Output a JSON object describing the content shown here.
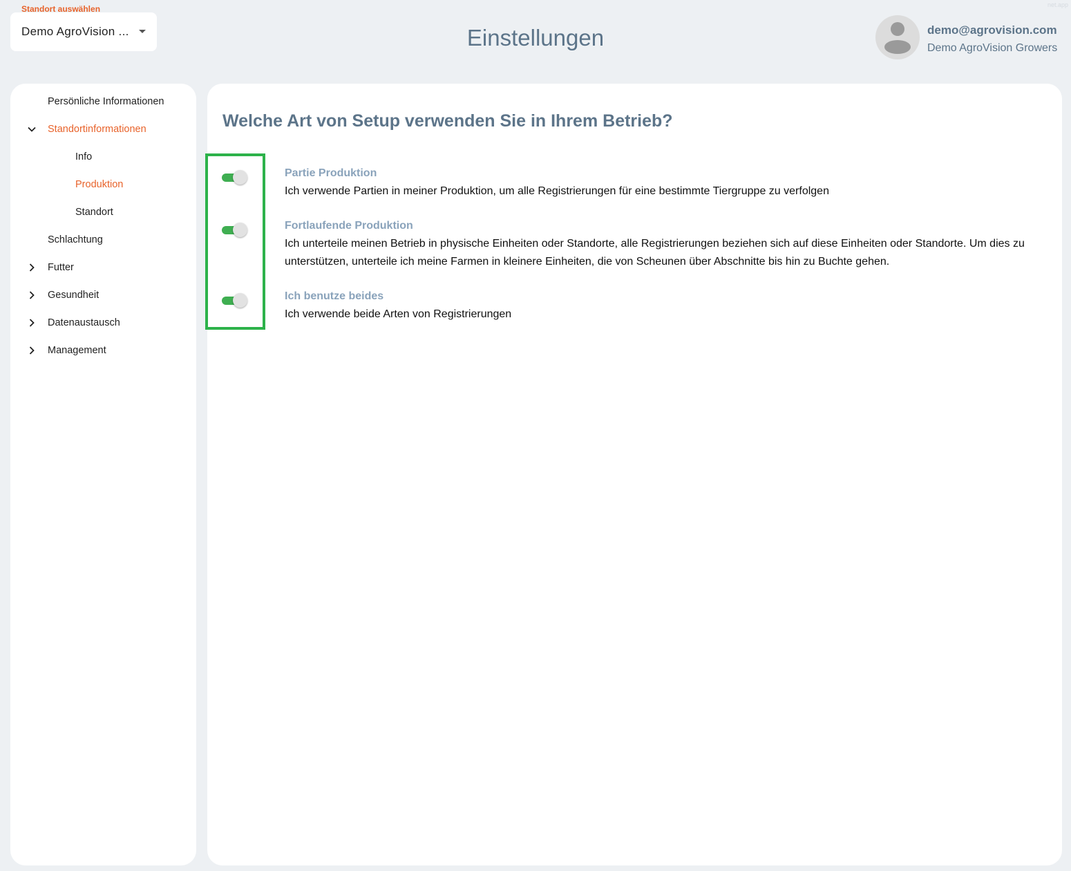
{
  "location_select": {
    "label": "Standort auswählen",
    "value": "Demo AgroVision ..."
  },
  "header": {
    "title": "Einstellungen",
    "watermark": "net.app"
  },
  "user": {
    "email": "demo@agrovision.com",
    "organization": "Demo AgroVision Growers"
  },
  "sidebar": {
    "items": [
      {
        "label": "Persönliche Informationen"
      },
      {
        "label": "Standortinformationen"
      },
      {
        "label": "Info"
      },
      {
        "label": "Produktion"
      },
      {
        "label": "Standort"
      },
      {
        "label": "Schlachtung"
      },
      {
        "label": "Futter"
      },
      {
        "label": "Gesundheit"
      },
      {
        "label": "Datenaustausch"
      },
      {
        "label": "Management"
      }
    ]
  },
  "main": {
    "question": "Welche Art von Setup verwenden Sie in Ihrem Betrieb?",
    "options": [
      {
        "title": "Partie Produktion",
        "description": "Ich verwende Partien in meiner Produktion, um alle Registrierungen für eine bestimmte Tiergruppe zu verfolgen",
        "enabled": true
      },
      {
        "title": "Fortlaufende Produktion",
        "description": "Ich unterteile meinen Betrieb in physische Einheiten oder Standorte, alle Registrierungen beziehen sich auf diese Einheiten oder Standorte. Um dies zu unterstützen, unterteile ich meine Farmen in kleinere Einheiten, die von Scheunen über Abschnitte bis hin zu Buchte gehen.",
        "enabled": true
      },
      {
        "title": "Ich benutze beides",
        "description": "Ich verwende beide Arten von Registrierungen",
        "enabled": true
      }
    ]
  },
  "colors": {
    "accent": "#e8632b",
    "toggle_on": "#3fae51",
    "highlight": "#2db24a",
    "heading": "#5c7489",
    "option_title": "#8aa3bb"
  }
}
